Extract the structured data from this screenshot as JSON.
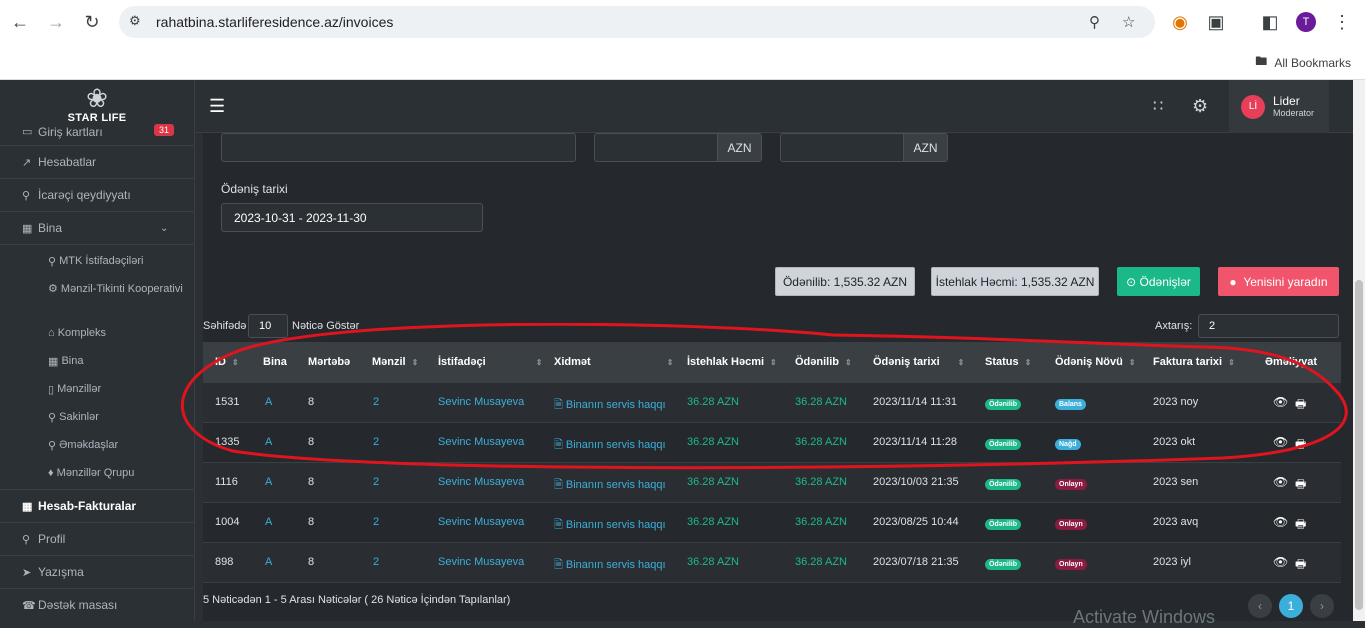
{
  "browser": {
    "url": "rahatbina.starliferesidence.az/invoices",
    "bookmarks_label": "All Bookmarks",
    "profile_initial": "T"
  },
  "sidebar": {
    "logo_text": "STAR LIFE",
    "items": [
      {
        "label": "Giriş kartları",
        "badge": "31",
        "icon": "card-icon"
      },
      {
        "label": "Hesabatlar",
        "icon": "chart-icon"
      },
      {
        "label": "İcarəçi qeydiyyatı",
        "icon": "user-add-icon"
      },
      {
        "label": "Bina",
        "icon": "building-icon"
      }
    ],
    "sub_items": [
      "MTK İstifadəçiləri",
      "Mənzil-Tikinti Kooperativi",
      "Kompleks",
      "Bina",
      "Mənzillər",
      "Sakinlər",
      "Əməkdaşlar",
      "Mənzillər Qrupu"
    ],
    "lower_items": [
      {
        "label": "Hesab-Fakturalar",
        "active": true
      },
      {
        "label": "Profil"
      },
      {
        "label": "Yazışma"
      },
      {
        "label": "Dəstək masası"
      }
    ]
  },
  "topbar": {
    "user_initials": "Lİ",
    "user_name": "Lider",
    "user_role": "Moderator"
  },
  "filters": {
    "currency": "AZN",
    "date_label": "Ödəniş tarixi",
    "date_value": "2023-10-31 - 2023-11-30"
  },
  "summary": {
    "paid": "Ödənilib: 1,535.32 AZN",
    "usage": "İstehlak Həcmi: 1,535.32 AZN",
    "payments_button": "Ödənişlər",
    "create_button": "Yenisini yaradın"
  },
  "table_controls": {
    "page_size_prefix": "Səhifədə",
    "page_size": "10",
    "page_size_suffix": "Nəticə Göstər",
    "search_label": "Axtarış:",
    "search_value": "2"
  },
  "table": {
    "headers": [
      "ID",
      "Bina",
      "Mərtəbə",
      "Mənzil",
      "İstifadəçi",
      "Xidmət",
      "İstehlak Həcmi",
      "Ödənilib",
      "Ödəniş tarixi",
      "Status",
      "Ödəniş Növü",
      "Faktura tarixi",
      "Əməliyyat"
    ],
    "rows": [
      {
        "id": "1531",
        "bina": "A",
        "floor": "8",
        "apt": "2",
        "user": "Sevinc Musayeva",
        "service": "Binanın servis haqqı",
        "usage": "36.28 AZN",
        "paid": "36.28 AZN",
        "date": "2023/11/14 11:31",
        "status": "Ödənilib",
        "type": "Balans",
        "type_color": "blue",
        "invoice": "2023 noy"
      },
      {
        "id": "1335",
        "bina": "A",
        "floor": "8",
        "apt": "2",
        "user": "Sevinc Musayeva",
        "service": "Binanın servis haqqı",
        "usage": "36.28 AZN",
        "paid": "36.28 AZN",
        "date": "2023/11/14 11:28",
        "status": "Ödənilib",
        "type": "Nağd",
        "type_color": "blue",
        "invoice": "2023 okt"
      },
      {
        "id": "1116",
        "bina": "A",
        "floor": "8",
        "apt": "2",
        "user": "Sevinc Musayeva",
        "service": "Binanın servis haqqı",
        "usage": "36.28 AZN",
        "paid": "36.28 AZN",
        "date": "2023/10/03 21:35",
        "status": "Ödənilib",
        "type": "Onlayn",
        "type_color": "maroon",
        "invoice": "2023 sen"
      },
      {
        "id": "1004",
        "bina": "A",
        "floor": "8",
        "apt": "2",
        "user": "Sevinc Musayeva",
        "service": "Binanın servis haqqı",
        "usage": "36.28 AZN",
        "paid": "36.28 AZN",
        "date": "2023/08/25 10:44",
        "status": "Ödənilib",
        "type": "Onlayn",
        "type_color": "maroon",
        "invoice": "2023 avq"
      },
      {
        "id": "898",
        "bina": "A",
        "floor": "8",
        "apt": "2",
        "user": "Sevinc Musayeva",
        "service": "Binanın servis haqqı",
        "usage": "36.28 AZN",
        "paid": "36.28 AZN",
        "date": "2023/07/18 21:35",
        "status": "Ödənilib",
        "type": "Onlayn",
        "type_color": "maroon",
        "invoice": "2023 iyl"
      }
    ]
  },
  "footer": {
    "summary": "5 Nəticədən 1 - 5 Arası Nəticələr ( 26 Nəticə İçindən Tapılanlar)",
    "current_page": "1",
    "watermark": "Activate Windows"
  },
  "colors": {
    "accent_blue": "#3bafda",
    "accent_green": "#1bb98a",
    "accent_red": "#f1556c",
    "annotation_red": "#e0141e"
  }
}
